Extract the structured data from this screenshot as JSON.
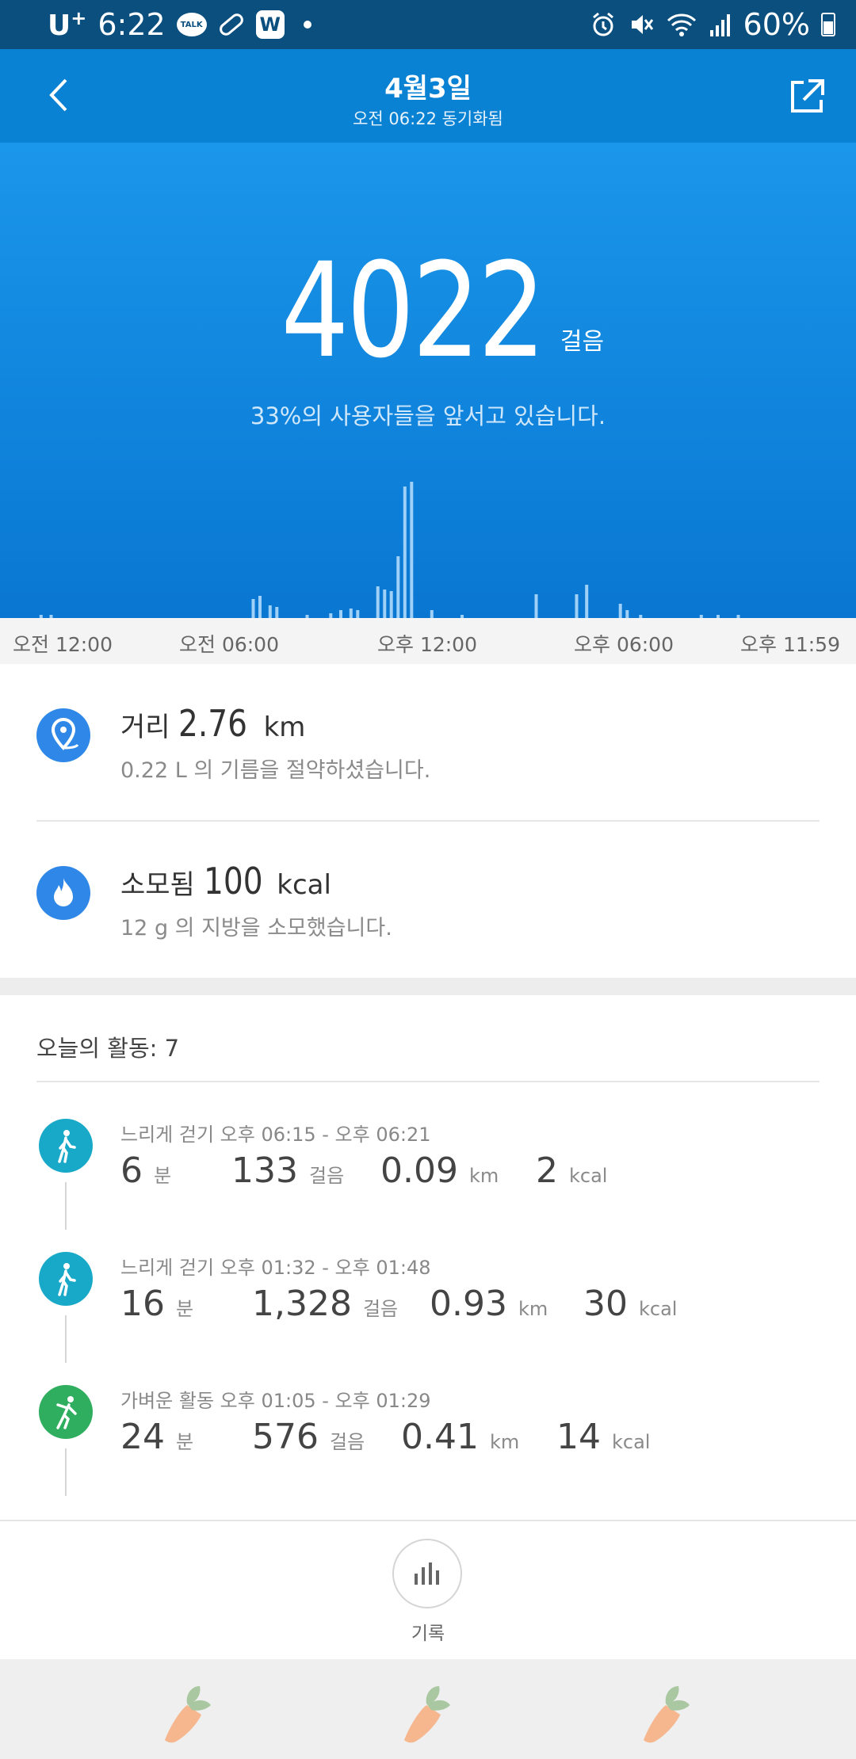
{
  "status_bar": {
    "carrier": "U",
    "carrier_sup": "+",
    "time": "6:22",
    "talk_label": "TALK",
    "w_label": "W",
    "battery": "60%"
  },
  "header": {
    "title": "4월3일",
    "subtitle": "오전 06:22 동기화됨"
  },
  "hero": {
    "steps": "4022",
    "steps_unit": "걸음",
    "rank_text": "33%의 사용자들을 앞서고 있습니다."
  },
  "chart_data": {
    "type": "bar",
    "x_ticks": [
      "오전 12:00",
      "오전 06:00",
      "오후 12:00",
      "오후 06:00",
      "오후 11:59"
    ],
    "bars": [
      {
        "hour": 0.7,
        "value": 2
      },
      {
        "hour": 1.0,
        "value": 2
      },
      {
        "hour": 7.0,
        "value": 12
      },
      {
        "hour": 7.2,
        "value": 14
      },
      {
        "hour": 7.5,
        "value": 8
      },
      {
        "hour": 7.7,
        "value": 7
      },
      {
        "hour": 8.6,
        "value": 2
      },
      {
        "hour": 9.3,
        "value": 3
      },
      {
        "hour": 9.6,
        "value": 5
      },
      {
        "hour": 9.9,
        "value": 6
      },
      {
        "hour": 10.1,
        "value": 5
      },
      {
        "hour": 10.7,
        "value": 20
      },
      {
        "hour": 10.9,
        "value": 18
      },
      {
        "hour": 11.1,
        "value": 17
      },
      {
        "hour": 11.3,
        "value": 39
      },
      {
        "hour": 11.5,
        "value": 83
      },
      {
        "hour": 11.7,
        "value": 86
      },
      {
        "hour": 12.3,
        "value": 5
      },
      {
        "hour": 13.2,
        "value": 2
      },
      {
        "hour": 15.4,
        "value": 15
      },
      {
        "hour": 16.6,
        "value": 15
      },
      {
        "hour": 16.9,
        "value": 21
      },
      {
        "hour": 17.9,
        "value": 9
      },
      {
        "hour": 18.1,
        "value": 5
      },
      {
        "hour": 18.5,
        "value": 2
      },
      {
        "hour": 20.3,
        "value": 2
      },
      {
        "hour": 20.8,
        "value": 2
      },
      {
        "hour": 21.4,
        "value": 2
      }
    ],
    "xlim": [
      0,
      24
    ],
    "ylim": [
      0,
      100
    ]
  },
  "summary": {
    "distance": {
      "label": "거리",
      "value": "2.76",
      "unit": "km",
      "sub": "0.22 L 의 기름을 절약하셨습니다."
    },
    "calories": {
      "label": "소모됨",
      "value": "100",
      "unit": "kcal",
      "sub": "12 g 의 지방을 소모했습니다."
    }
  },
  "activities": {
    "title": "오늘의 활동:",
    "count": "7",
    "items": [
      {
        "header": "느리게 걷기 오후 06:15 - 오후 06:21",
        "minutes": "6",
        "steps": "133",
        "km": "0.09",
        "kcal": "2",
        "color": "#18a9c9",
        "icon": "walking-icon"
      },
      {
        "header": "느리게 걷기 오후 01:32 - 오후 01:48",
        "minutes": "16",
        "steps": "1,328",
        "km": "0.93",
        "kcal": "30",
        "color": "#18a9c9",
        "icon": "walking-icon"
      },
      {
        "header": "가벼운 활동 오후 01:05 - 오후 01:29",
        "minutes": "24",
        "steps": "576",
        "km": "0.41",
        "kcal": "14",
        "color": "#2fae5f",
        "icon": "light-activity-icon"
      }
    ],
    "units": {
      "min": "분",
      "steps": "걸음",
      "km": "km",
      "kcal": "kcal"
    }
  },
  "bottom": {
    "record_label": "기록"
  },
  "colors": {
    "header_bg": "#0a82d4",
    "status_bg": "#0a4f7e",
    "accent": "#2f88e8"
  }
}
